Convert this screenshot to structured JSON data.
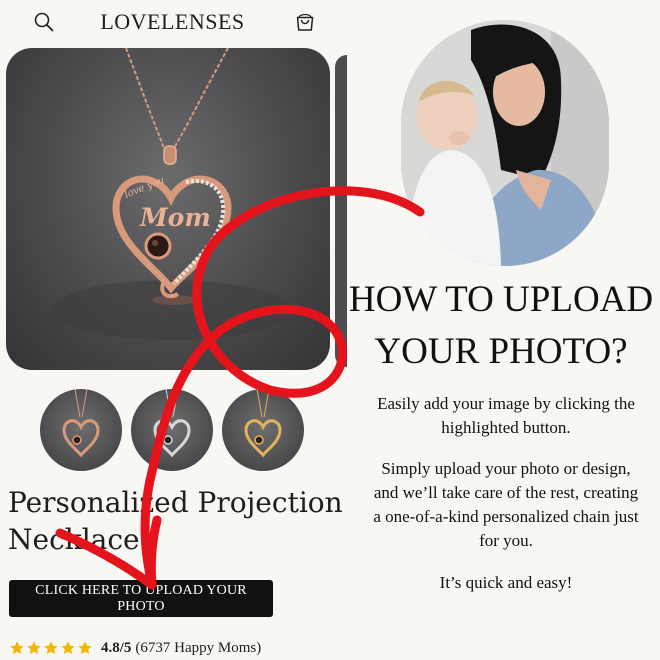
{
  "header": {
    "logo": "LOVELENSES",
    "search_icon": "search-icon",
    "cart_icon": "shopping-bag-icon"
  },
  "product": {
    "title": "Personalized Projection Necklace",
    "pendant_text_top": "love you",
    "pendant_text_main": "Mom",
    "thumbnails": [
      "rose-gold",
      "silver",
      "gold"
    ]
  },
  "upload": {
    "button_label": "CLICK HERE TO UPLOAD YOUR PHOTO"
  },
  "rating": {
    "stars": 5,
    "value": "4.8/5",
    "count": "(6737 Happy Moms)"
  },
  "guide": {
    "heading": "HOW TO UPLOAD YOUR PHOTO?",
    "paragraph_1": "Easily add your image by clicking the highlighted button.",
    "paragraph_2": "Simply upload your photo or design, and we’ll take care of the rest, creating a one-of-a-kind personalized chain just for you.",
    "paragraph_3": "It’s quick and easy!"
  },
  "colors": {
    "arrow": "#e5141c",
    "button_bg": "#111111",
    "star": "#f2b705",
    "background": "#f8f7f3"
  }
}
